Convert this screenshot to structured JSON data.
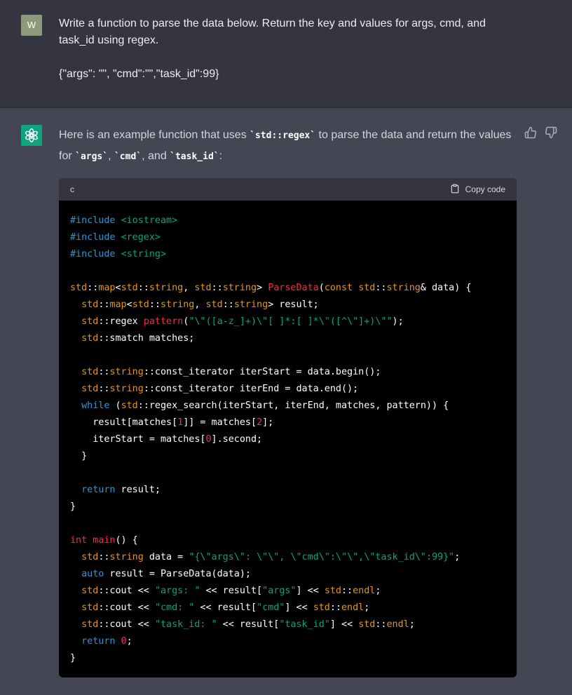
{
  "user_message": {
    "avatar_letter": "W",
    "line1": "Write a function to parse the data below. Return the key and values for args, cmd, and task_id using regex.",
    "line2": "{\"args\": \"\", \"cmd\":\"\",\"task_id\":99}"
  },
  "assistant_message": {
    "intro_prefix": "Here is an example function that uses ",
    "intro_code1": "`std::regex`",
    "intro_mid1": " to parse the data and return the values for ",
    "intro_code2": "`args`",
    "intro_sep1": ", ",
    "intro_code3": "`cmd`",
    "intro_sep2": ", and ",
    "intro_code4": "`task_id`",
    "intro_suffix": ":"
  },
  "code_block": {
    "language": "c",
    "copy_label": "Copy code"
  },
  "icons": {
    "bot_avatar": "openai-logo-icon",
    "thumbs_up": "thumbs-up-icon",
    "thumbs_down": "thumbs-down-icon",
    "copy": "clipboard-icon"
  },
  "colors": {
    "user_bg": "#343541",
    "assistant_bg": "#444654",
    "bot_avatar_bg": "#10a37f",
    "user_avatar_bg": "#8d9979",
    "code_bg": "#000000",
    "code_header_bg": "#343541",
    "keyword": "#2e95d3",
    "string": "#00a67d",
    "number": "#df3079",
    "type": "#f22c3d",
    "operator": "#e9950c"
  }
}
